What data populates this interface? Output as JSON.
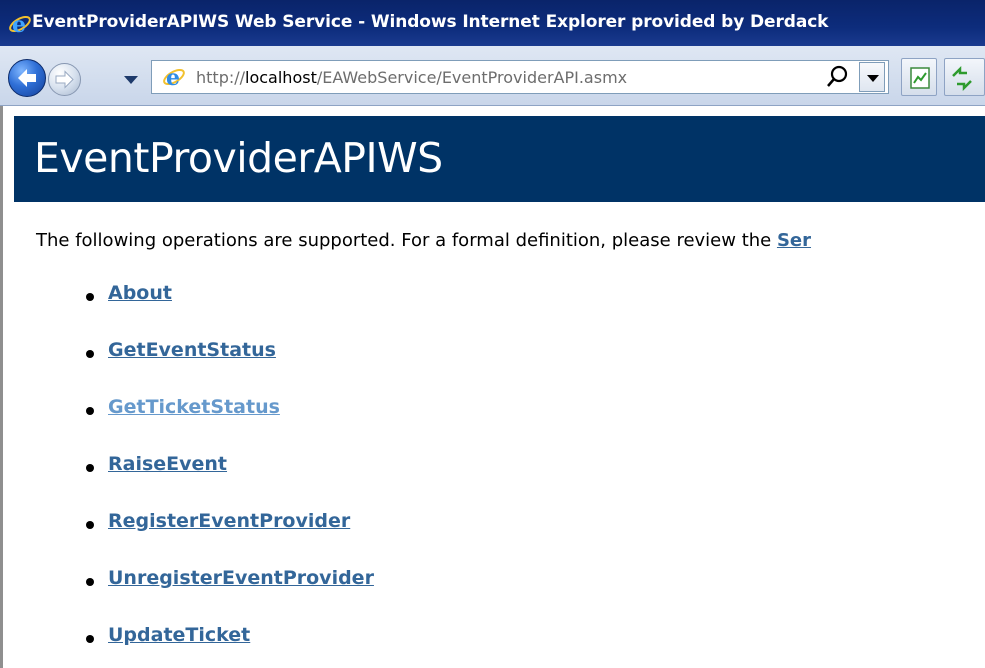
{
  "window": {
    "title": "EventProviderAPIWS Web Service - Windows Internet Explorer provided by Derdack"
  },
  "toolbar": {
    "url_prefix": "http://",
    "url_host": "localhost",
    "url_path": "/EAWebService/EventProviderAPI.asmx"
  },
  "page": {
    "heading": "EventProviderAPIWS",
    "intro_text": "The following operations are supported. For a formal definition, please review the ",
    "intro_link": "Ser",
    "operations": [
      {
        "label": "About"
      },
      {
        "label": "GetEventStatus"
      },
      {
        "label": "GetTicketStatus"
      },
      {
        "label": "RaiseEvent"
      },
      {
        "label": "RegisterEventProvider"
      },
      {
        "label": "UnregisterEventProvider"
      },
      {
        "label": "UpdateTicket"
      }
    ]
  },
  "colors": {
    "header_band": "#003366",
    "link": "#336699",
    "visited_link": "#6699cc",
    "titlebar": "#0a246a"
  },
  "icons": {
    "browser": "ie-logo-icon",
    "back": "back-arrow-icon",
    "forward": "forward-arrow-icon",
    "search": "search-icon",
    "compat": "compatibility-view-icon",
    "refresh": "refresh-icon"
  }
}
